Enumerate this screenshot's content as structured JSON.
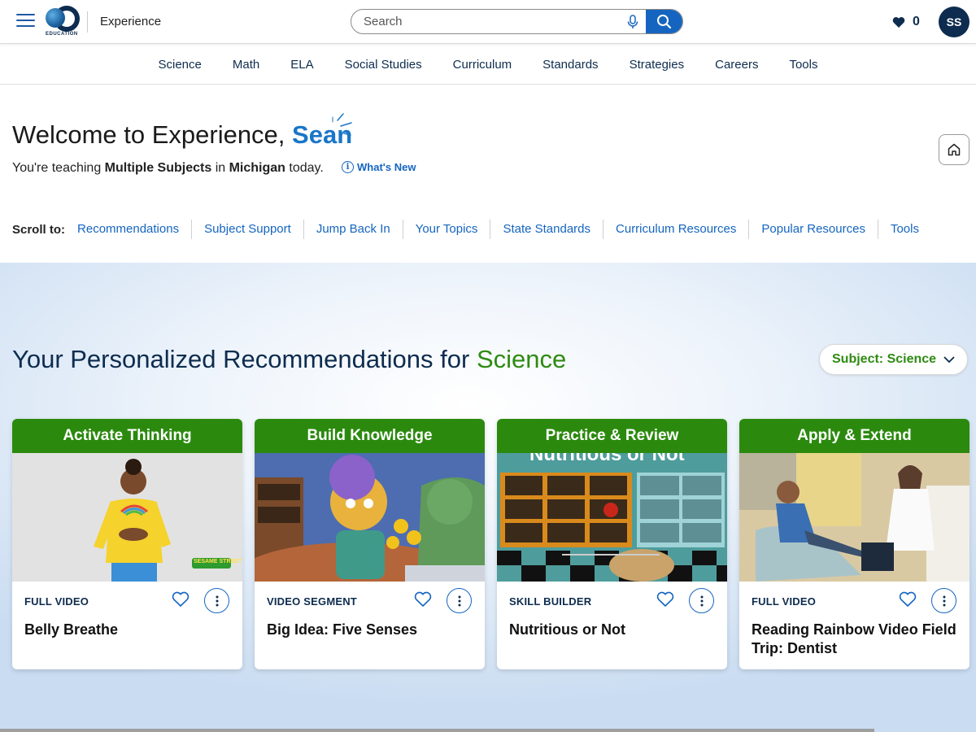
{
  "header": {
    "brand_logo_text": "EDUCATION",
    "brand_name": "Experience",
    "search_placeholder": "Search",
    "favorites_count": "0",
    "avatar_initials": "SS"
  },
  "subject_nav": [
    "Science",
    "Math",
    "ELA",
    "Social Studies",
    "Curriculum",
    "Standards",
    "Strategies",
    "Careers",
    "Tools"
  ],
  "welcome": {
    "prefix": "Welcome to Experience, ",
    "name": "Sean",
    "teaching_prefix": "You're teaching ",
    "subjects": "Multiple Subjects",
    "teaching_mid": " in ",
    "state": "Michigan",
    "teaching_suffix": " today.",
    "whats_new": "What's New",
    "info_glyph": "i"
  },
  "scroll_to": {
    "label": "Scroll to:",
    "links": [
      "Recommendations",
      "Subject Support",
      "Jump Back In",
      "Your Topics",
      "State Standards",
      "Curriculum Resources",
      "Popular Resources",
      "Tools"
    ]
  },
  "recommendations": {
    "title_prefix": "Your Personalized Recommendations for ",
    "title_subject": "Science",
    "subject_select": "Subject: Science",
    "cards": [
      {
        "header": "Activate Thinking",
        "type": "FULL VIDEO",
        "title": "Belly Breathe",
        "badge": "SESAME STREET"
      },
      {
        "header": "Build Knowledge",
        "type": "VIDEO SEGMENT",
        "title": "Big Idea: Five Senses"
      },
      {
        "header": "Practice & Review",
        "type": "SKILL BUILDER",
        "title": "Nutritious or Not",
        "image_caption": "Nutritious or Not"
      },
      {
        "header": "Apply & Extend",
        "type": "FULL VIDEO",
        "title": "Reading Rainbow Video Field Trip: Dentist"
      }
    ]
  },
  "colors": {
    "brand_navy": "#0d2c4f",
    "link_blue": "#1565c0",
    "accent_green": "#2b8a0e",
    "name_blue": "#1976c8"
  },
  "icons": {
    "menu": "hamburger-icon",
    "search": "magnifier-icon",
    "mic": "microphone-icon",
    "favorites": "heart-icon",
    "home": "home-icon",
    "more": "kebab-icon",
    "dropdown": "chevron-down-icon"
  }
}
